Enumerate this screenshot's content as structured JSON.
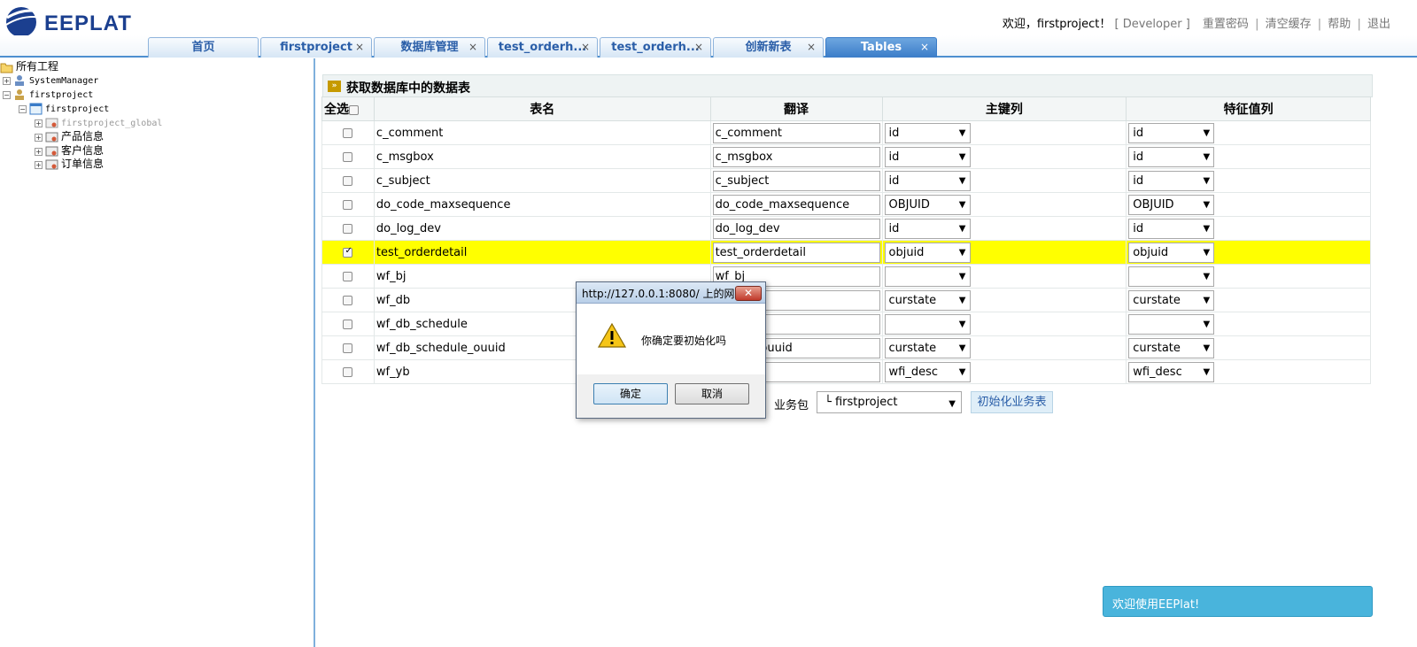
{
  "app": {
    "logo_text": "EEPLAT"
  },
  "topnav": {
    "welcome": "欢迎，firstproject！",
    "role": "[ Developer ]",
    "reset_password": "重置密码",
    "clear_cache": "清空缓存",
    "help": "帮助",
    "logout": "退出",
    "separator": "|"
  },
  "tabs": [
    {
      "label": "首页",
      "closable": false
    },
    {
      "label": "firstproject",
      "closable": true
    },
    {
      "label": "数据库管理",
      "closable": true
    },
    {
      "label": "test_orderh...",
      "closable": true
    },
    {
      "label": "test_orderh...",
      "closable": true
    },
    {
      "label": "创新新表",
      "closable": true
    },
    {
      "label": "Tables",
      "closable": true,
      "active": true
    }
  ],
  "tab_close_glyph": "×",
  "tree": {
    "root": "所有工程",
    "system_manager": "SystemManager",
    "project": "firstproject",
    "project_child": "firstproject",
    "global": "firstproject_global",
    "product": "产品信息",
    "customer": "客户信息",
    "order": "订单信息"
  },
  "panel": {
    "title": "获取数据库中的数据表"
  },
  "grid": {
    "headers": {
      "select_all": "全选",
      "table_name": "表名",
      "translation": "翻译",
      "primary_key": "主键列",
      "feature_value": "特征值列"
    },
    "rows": [
      {
        "checked": false,
        "name": "c_comment",
        "translation": "c_comment",
        "pk": "id",
        "feature": "id"
      },
      {
        "checked": false,
        "name": "c_msgbox",
        "translation": "c_msgbox",
        "pk": "id",
        "feature": "id"
      },
      {
        "checked": false,
        "name": "c_subject",
        "translation": "c_subject",
        "pk": "id",
        "feature": "id"
      },
      {
        "checked": false,
        "name": "do_code_maxsequence",
        "translation": "do_code_maxsequence",
        "pk": "OBJUID",
        "feature": "OBJUID"
      },
      {
        "checked": false,
        "name": "do_log_dev",
        "translation": "do_log_dev",
        "pk": "id",
        "feature": "id"
      },
      {
        "checked": true,
        "name": "test_orderdetail",
        "translation": "test_orderdetail",
        "pk": "objuid",
        "feature": "objuid"
      },
      {
        "checked": false,
        "name": "wf_bj",
        "translation": "wf_bj",
        "pk": "",
        "feature": ""
      },
      {
        "checked": false,
        "name": "wf_db",
        "translation": "",
        "pk": "curstate",
        "feature": "curstate"
      },
      {
        "checked": false,
        "name": "wf_db_schedule",
        "translation": "nedule",
        "pk": "",
        "feature": ""
      },
      {
        "checked": false,
        "name": "wf_db_schedule_ouuid",
        "translation": "nedule_ouuid",
        "pk": "curstate",
        "feature": "curstate"
      },
      {
        "checked": false,
        "name": "wf_yb",
        "translation": "",
        "pk": "wfi_desc",
        "feature": "wfi_desc"
      }
    ]
  },
  "bottom": {
    "package_label": "业务包",
    "package_value": "└ firstproject",
    "init_button": "初始化业务表"
  },
  "dialog": {
    "title": "http://127.0.0.1:8080/ 上的网...",
    "close_glyph": "✕",
    "message": "你确定要初始化吗",
    "ok": "确定",
    "cancel": "取消"
  },
  "dropdown_arrow": "▼",
  "expander_glyph": "+",
  "collapse_glyph": "−",
  "toast": {
    "message": "欢迎使用EEPlat!"
  },
  "colors": {
    "accent": "#3a7cc8",
    "selected_row": "#ffff00",
    "toast_bg": "#49b4dc",
    "logo": "#1b3f8f"
  }
}
